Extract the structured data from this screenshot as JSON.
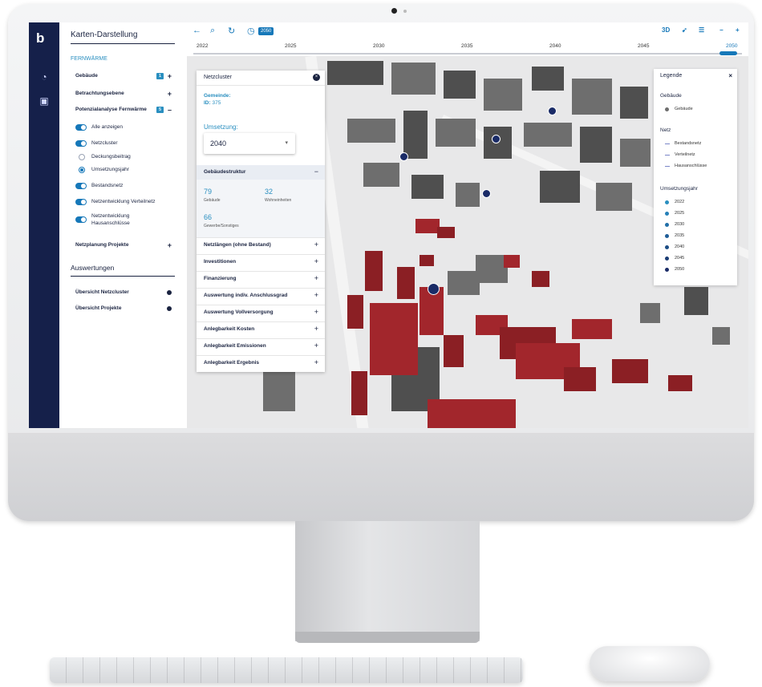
{
  "app": {
    "title": "Karten-Darstellung",
    "section": "FERNWÄRME",
    "logo": "b"
  },
  "rail_icons": [
    "dashboard-icon",
    "map-layers-icon"
  ],
  "sidebar": {
    "items": [
      {
        "label": "Gebäude",
        "badge": "1",
        "sign": "+"
      },
      {
        "label": "Betrachtungsebene",
        "sign": "+"
      },
      {
        "label": "Potenzialanalyse Fernwärme",
        "badge": "5",
        "sign": "–"
      }
    ],
    "toggles": [
      {
        "label": "Alle anzeigen",
        "on": true
      },
      {
        "label": "Netzcluster",
        "on": true
      }
    ],
    "radios": [
      {
        "label": "Deckungsbeitrag",
        "selected": false
      },
      {
        "label": "Umsetzungsjahr",
        "selected": true
      }
    ],
    "toggles2": [
      {
        "label": "Bestandsnetz",
        "on": true
      },
      {
        "label": "Netzentwicklung Verteilnetz",
        "on": true
      },
      {
        "label_line1": "Netzentwicklung",
        "label_line2": "Hausanschlüsse",
        "on": true
      }
    ],
    "netzplanung": {
      "label": "Netzplanung Projekte",
      "sign": "+"
    },
    "auswertungen": {
      "title": "Auswertungen",
      "items": [
        "Übersicht Netzcluster",
        "Übersicht Projekte"
      ]
    }
  },
  "toolbar": {
    "year_chip": "2050",
    "mode_3d": "3D"
  },
  "timeline": {
    "ticks": [
      "2022",
      "2025",
      "2030",
      "2035",
      "2040",
      "2045",
      "2050"
    ],
    "selected": "2050"
  },
  "panel": {
    "title": "Netzcluster",
    "gemeinde_label": "Gemeinde:",
    "id_label": "ID:",
    "id_value": "375",
    "umsetzung_label": "Umsetzung:",
    "umsetzung_value": "2040",
    "open_section": "Gebäudestruktur",
    "stats": [
      {
        "value": "79",
        "label": "Gebäude"
      },
      {
        "value": "32",
        "label": "Wohneinheiten"
      },
      {
        "value": "66",
        "label": "Gewerbe/Sonstiges"
      }
    ],
    "sections": [
      "Netzlängen (ohne Bestand)",
      "Investitionen",
      "Finanzierung",
      "Auswertung indiv. Anschlussgrad",
      "Auswertung Vollversorgung",
      "Anlegbarkeit Kosten",
      "Anlegbarkeit Emissionen",
      "Anlegbarkeit Ergebnis"
    ]
  },
  "legend": {
    "title": "Legende",
    "gebaeude_heading": "Gebäude",
    "gebaeude_item": "Gebäude",
    "netz_heading": "Netz",
    "netz_items": [
      "Bestandsnetz",
      "Verteilnetz",
      "Hausanschlüsse"
    ],
    "jahr_heading": "Umsetzungsjahr",
    "jahre": [
      "2022",
      "2025",
      "2030",
      "2035",
      "2040",
      "2045",
      "2050"
    ]
  },
  "colors": {
    "navy": "#15204a",
    "accent": "#1678b9",
    "building": "#6e6e6e",
    "cluster": "#8b1f24"
  }
}
